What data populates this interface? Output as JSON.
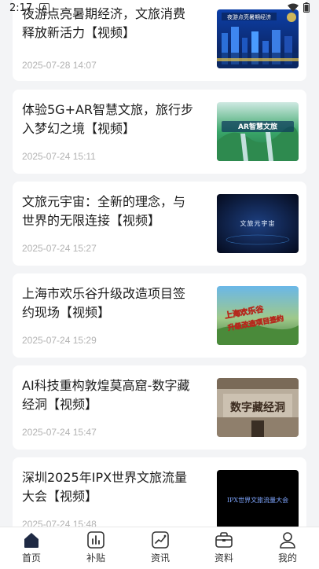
{
  "status_bar": {
    "time": "2:17",
    "notif": "A"
  },
  "articles": [
    {
      "title": "夜游点亮暑期经济，文旅消费释放新活力【视频】",
      "time": "2025-07-28 14:07",
      "thumb_text": "夜游点亮暑期经济",
      "thumb_sub": ""
    },
    {
      "title": "体验5G+AR智慧文旅，旅行步入梦幻之境【视频】",
      "time": "2025-07-24 15:11",
      "thumb_text": "AR智慧文旅",
      "thumb_sub": ""
    },
    {
      "title": "文旅元宇宙：全新的理念，与世界的无限连接【视频】",
      "time": "2025-07-24 15:27",
      "thumb_text": "文旅元宇宙",
      "thumb_sub": ""
    },
    {
      "title": "上海市欢乐谷升级改造项目签约现场【视频】",
      "time": "2025-07-24 15:29",
      "thumb_text": "上海欢乐谷",
      "thumb_sub": "升级改造项目签约"
    },
    {
      "title": "AI科技重构敦煌莫高窟-数字藏经洞【视频】",
      "time": "2025-07-24 15:47",
      "thumb_text": "数字藏经洞",
      "thumb_sub": ""
    },
    {
      "title": "深圳2025年IPX世界文旅流量大会【视频】",
      "time": "2025-07-24 15:48",
      "thumb_text": "IPX世界文旅流量大会",
      "thumb_sub": ""
    }
  ],
  "tabs": [
    {
      "label": "首页",
      "icon": "home-icon"
    },
    {
      "label": "补贴",
      "icon": "bar-chart-icon"
    },
    {
      "label": "资讯",
      "icon": "trend-icon"
    },
    {
      "label": "资料",
      "icon": "briefcase-icon"
    },
    {
      "label": "我的",
      "icon": "user-icon"
    }
  ]
}
